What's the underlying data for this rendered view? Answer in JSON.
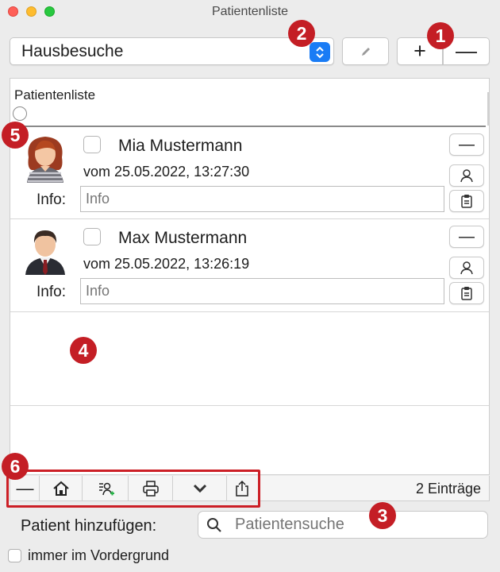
{
  "window": {
    "title": "Patientenliste"
  },
  "list_select": {
    "value": "Hausbesuche"
  },
  "list_buttons": {
    "add": "+",
    "remove": "—"
  },
  "list": {
    "header": "Patientenliste",
    "patients": [
      {
        "name": "Mia Mustermann",
        "date": "vom 25.05.2022, 13:27:30",
        "info_label": "Info:",
        "info_placeholder": "Info",
        "remove_label": "—"
      },
      {
        "name": "Max Mustermann",
        "date": "vom 25.05.2022, 13:26:19",
        "info_label": "Info:",
        "info_placeholder": "Info",
        "remove_label": "—"
      }
    ]
  },
  "toolbar": {
    "remove_label": "—",
    "entries": "2 Einträge"
  },
  "add_patient": {
    "label": "Patient hinzufügen:",
    "search_placeholder": "Patientensuche"
  },
  "foreground": {
    "label": "immer im Vordergrund"
  },
  "callouts": [
    "1",
    "2",
    "3",
    "4",
    "5",
    "6"
  ],
  "colors": {
    "accent": "#1a7cf5",
    "callout": "#c41e25"
  }
}
